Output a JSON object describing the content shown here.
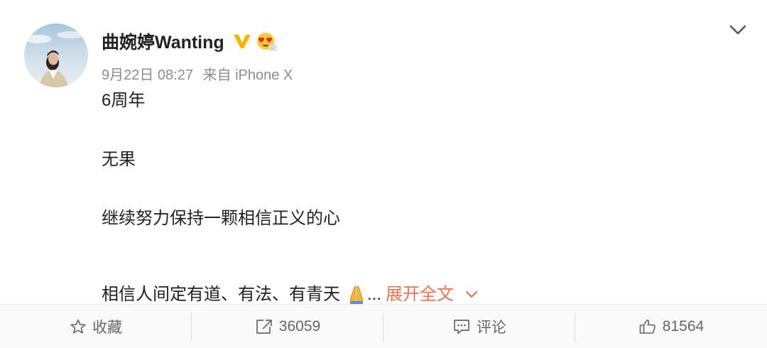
{
  "post": {
    "user": {
      "name": "曲婉婷Wanting",
      "verified_icon": "verified-v-icon",
      "badge_icon": "heart-eyes-emoji-icon"
    },
    "meta": {
      "date": "9月22日 08:27",
      "source": "来自 iPhone X"
    },
    "content": {
      "lines": [
        "6周年",
        "无果",
        "继续努力保持一颗相信正义的心",
        "相信人间定有道、有法、有青天"
      ],
      "emoji": "praying-hands-icon",
      "ellipsis": "...",
      "expand_label": "展开全文"
    }
  },
  "footer": {
    "favorite": {
      "label": "收藏",
      "icon": "star-icon"
    },
    "repost": {
      "count": "36059",
      "icon": "share-icon"
    },
    "comment": {
      "label": "评论",
      "icon": "comment-icon"
    },
    "like": {
      "count": "81564",
      "icon": "thumbs-up-icon"
    }
  },
  "colors": {
    "accent": "#eb7350",
    "verified": "#f7b500",
    "text": "#222222",
    "muted": "#8c8c8c"
  }
}
